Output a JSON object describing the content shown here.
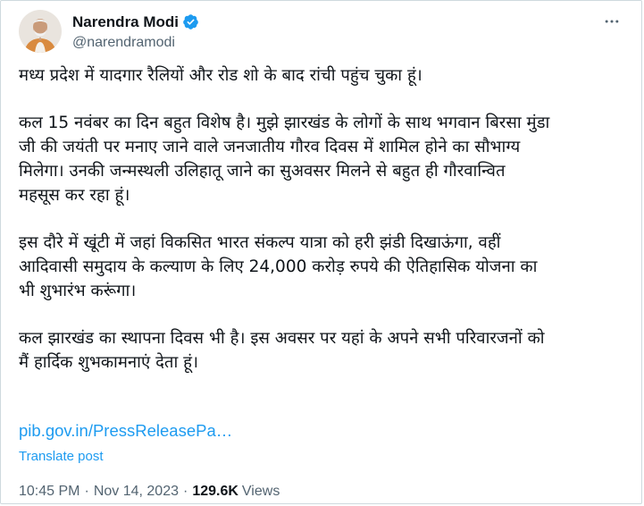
{
  "author": {
    "display_name": "Narendra Modi",
    "handle": "@narendramodi",
    "verified": true,
    "avatar_icon": "user-avatar",
    "verified_color": "#1d9bf0"
  },
  "menu": {
    "icon": "more-horizontal-icon"
  },
  "post": {
    "paragraphs": [
      "मध्य प्रदेश में यादगार रैलियों और रोड शो के बाद रांची पहुंच चुका हूं।",
      "कल 15 नवंबर का दिन बहुत विशेष है। मुझे झारखंड के लोगों के साथ भगवान बिरसा मुंडा\nजी की जयंती पर मनाए जाने वाले जनजातीय गौरव दिवस में शामिल होने का सौभाग्य\nमिलेगा। उनकी जन्मस्थली उलिहातू जाने का सुअवसर मिलने से बहुत ही गौरवान्वित\nमहसूस कर रहा हूं।",
      "इस दौरे में खूंटी में जहां विकसित भारत संकल्प यात्रा को हरी झंडी दिखाऊंगा, वहीं\nआदिवासी समुदाय के कल्याण के लिए 24,000 करोड़ रुपये की ऐतिहासिक योजना का\nभी शुभारंभ करूंगा।",
      "कल झारखंड का स्थापना दिवस भी है। इस अवसर पर यहां के अपने सभी परिवारजनों को\nमैं हार्दिक शुभकामनाएं देता हूं।"
    ],
    "link_text": "pib.gov.in/PressReleasePa…",
    "translate_label": "Translate post"
  },
  "meta": {
    "time": "10:45 PM",
    "separator": "·",
    "date": "Nov 14, 2023",
    "views_count": "129.6K",
    "views_label": "Views"
  },
  "colors": {
    "accent": "#1d9bf0",
    "text": "#0f1419",
    "secondary": "#536471",
    "border": "#cfd9de"
  }
}
